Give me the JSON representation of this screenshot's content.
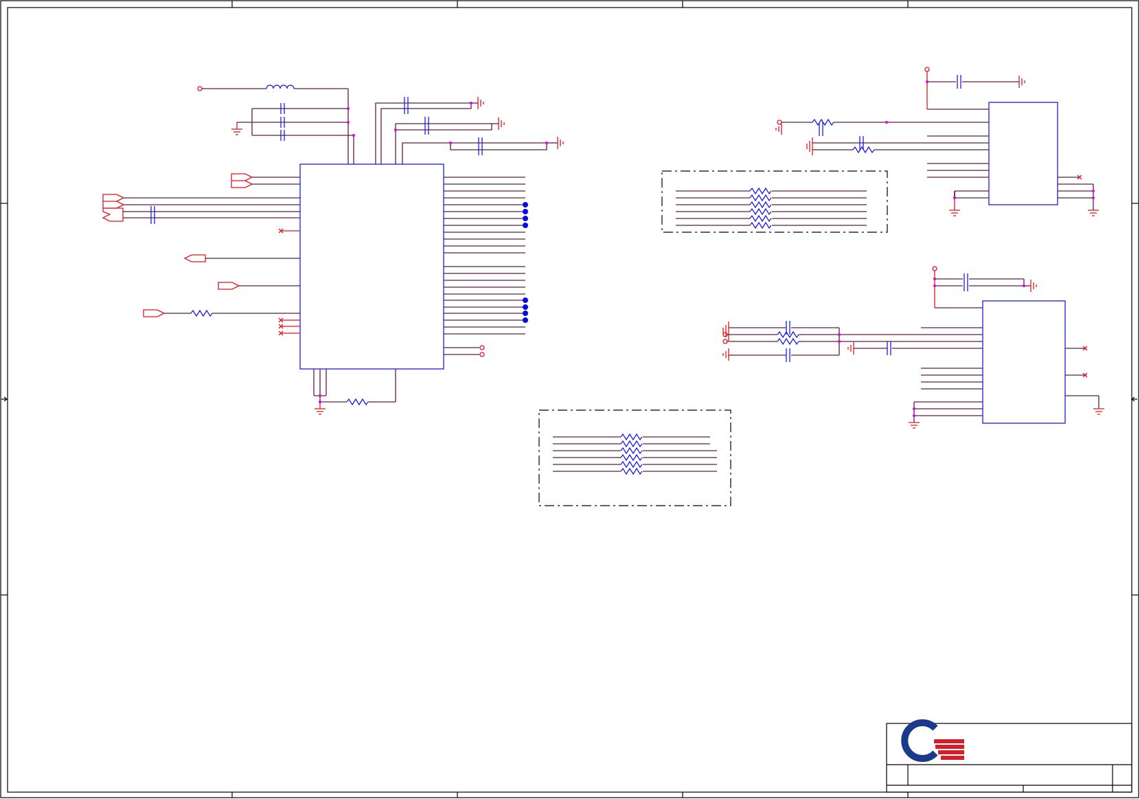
{
  "sheet": {
    "border_color": "#000000",
    "wire_color": "#e0141e",
    "net_color": "#5a1e3c",
    "part_color": "#1a1ae6",
    "junction_color": "#e000e0"
  },
  "logo": {
    "icon": "quanta-logo-icon",
    "colors": [
      "#1b3a8c",
      "#d0202a"
    ]
  }
}
